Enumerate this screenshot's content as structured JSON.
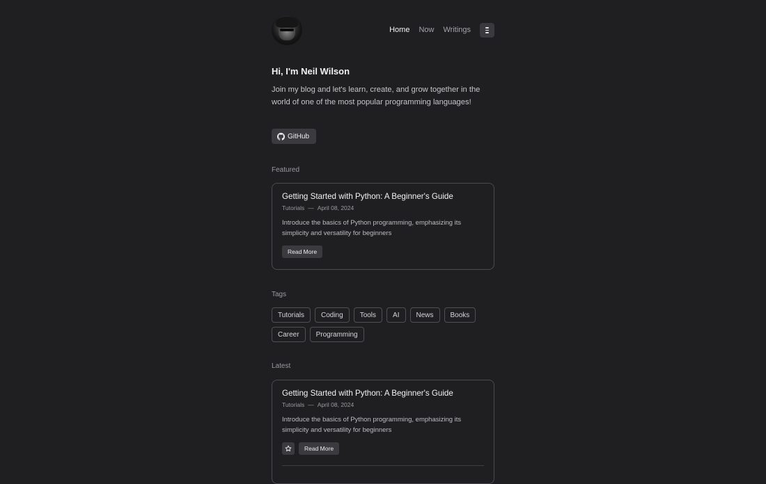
{
  "nav": {
    "items": [
      {
        "label": "Home",
        "active": true
      },
      {
        "label": "Now",
        "active": false
      },
      {
        "label": "Writings",
        "active": false
      }
    ]
  },
  "intro": {
    "greeting": "Hi, I'm Neil Wilson",
    "text": "Join my blog and let's learn, create, and grow together in the world of one of the most popular programming languages!",
    "github_label": "GitHub"
  },
  "featured": {
    "label": "Featured",
    "post": {
      "title": "Getting Started with Python: A Beginner's Guide",
      "category": "Tutorials",
      "date": "April 08, 2024",
      "description": "Introduce the basics of Python programming, emphasizing its simplicity and versatility for beginners",
      "button": "Read More"
    }
  },
  "tags": {
    "label": "Tags",
    "items": [
      "Tutorials",
      "Coding",
      "Tools",
      "AI",
      "News",
      "Books",
      "Career",
      "Programming"
    ]
  },
  "latest": {
    "label": "Latest",
    "post": {
      "title": "Getting Started with Python: A Beginner's Guide",
      "category": "Tutorials",
      "date": "April 08, 2024",
      "description": "Introduce the basics of Python programming, emphasizing its simplicity and versatility for beginners",
      "button": "Read More"
    }
  },
  "icons": {
    "github": "github-icon",
    "menu": "menu-icon",
    "star": "star-icon"
  },
  "colors": {
    "background": "#1f1f22",
    "button": "#3b3b3f",
    "border": "#4a4a4f"
  }
}
